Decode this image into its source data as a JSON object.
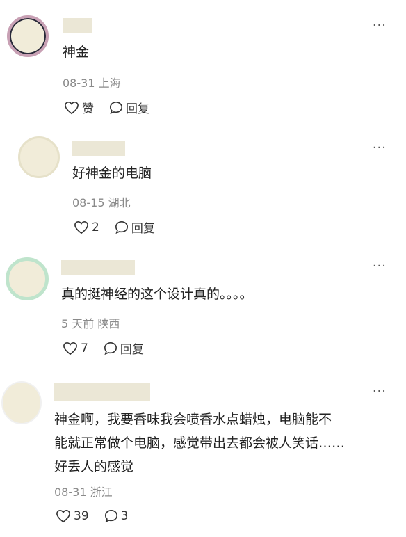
{
  "comments": [
    {
      "text": "神金",
      "meta": "08-31 上海",
      "like": "赞",
      "reply": "回复",
      "more": "···"
    },
    {
      "text": "好神金的电脑",
      "meta": "08-15 湖北",
      "like": "2",
      "reply": "回复",
      "more": "···"
    },
    {
      "text": "真的挺神经的这个设计真的。。。。",
      "meta": "5 天前 陕西",
      "like": "7",
      "reply": "回复",
      "more": "···"
    },
    {
      "text_lines": [
        "神金啊，我要香味我会喷香水点蜡烛，电脑能不",
        "能就正常做个电脑，感觉带出去都会被人笑话……",
        "好丢人的感觉"
      ],
      "meta": "08-31 浙江",
      "like": "39",
      "reply": "3",
      "more": "···"
    }
  ]
}
